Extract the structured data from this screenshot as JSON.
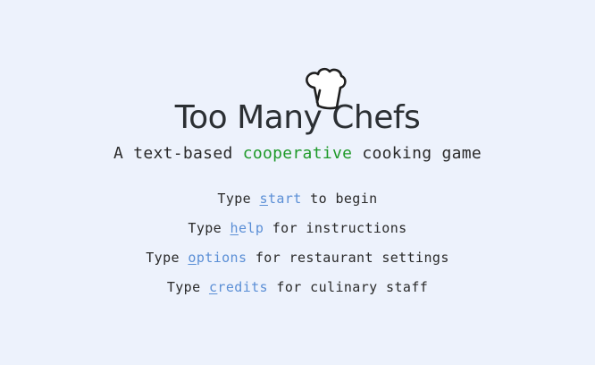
{
  "title": "Too Many Chefs",
  "subtitle": {
    "before": "A text-based ",
    "accent": "cooperative",
    "after": " cooking game"
  },
  "menu": [
    {
      "prefix": "Type ",
      "command_first": "s",
      "command_rest": "tart",
      "suffix": " to begin"
    },
    {
      "prefix": "Type ",
      "command_first": "h",
      "command_rest": "elp",
      "suffix": " for instructions"
    },
    {
      "prefix": "Type ",
      "command_first": "o",
      "command_rest": "ptions",
      "suffix": " for restaurant settings"
    },
    {
      "prefix": "Type ",
      "command_first": "c",
      "command_rest": "redits",
      "suffix": " for culinary staff"
    }
  ],
  "icons": {
    "hat": "chef-hat-icon"
  },
  "colors": {
    "background": "#edf2fc",
    "accent_green": "#1f9a2a",
    "command_blue": "#5b8fd6",
    "text": "#2a2a2a"
  }
}
